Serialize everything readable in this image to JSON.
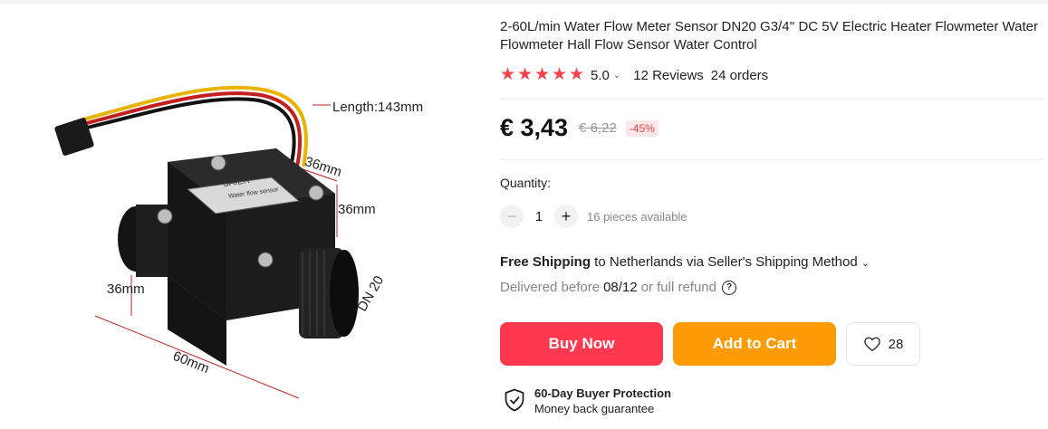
{
  "product": {
    "title": "2-60L/min Water Flow Meter Sensor DN20 G3/4'' DC 5V Electric Heater Flowmeter Water Flowmeter Hall Flow Sensor Water Control",
    "rating_value": "5.0",
    "stars": 5,
    "reviews": "12 Reviews",
    "orders": "24 orders"
  },
  "image_labels": {
    "length": "Length:143mm",
    "depth": "36mm",
    "height": "36mm",
    "side": "36mm",
    "width": "60mm",
    "thread": "DN 20",
    "brand": "SAIER",
    "model": "Water flow sensor"
  },
  "price": {
    "current": "€ 3,43",
    "original": "€ 6,22",
    "discount": "-45%"
  },
  "quantity": {
    "label": "Quantity:",
    "value": "1",
    "minus": "−",
    "plus": "+",
    "available": "16 pieces available"
  },
  "shipping": {
    "bold": "Free Shipping",
    "rest": " to Netherlands via Seller's Shipping Method",
    "chevron": "⌄",
    "delivered_prefix": "Delivered before",
    "delivered_date": "08/12",
    "delivered_suffix": "or full refund",
    "help": "?"
  },
  "actions": {
    "buy_now": "Buy Now",
    "add_to_cart": "Add to Cart",
    "wishlist_count": "28"
  },
  "protection": {
    "title": "60-Day Buyer Protection",
    "subtitle": "Money back guarantee"
  },
  "colors": {
    "accent_red": "#fd384f",
    "accent_orange": "#fd9b06",
    "star": "#f5424b"
  }
}
